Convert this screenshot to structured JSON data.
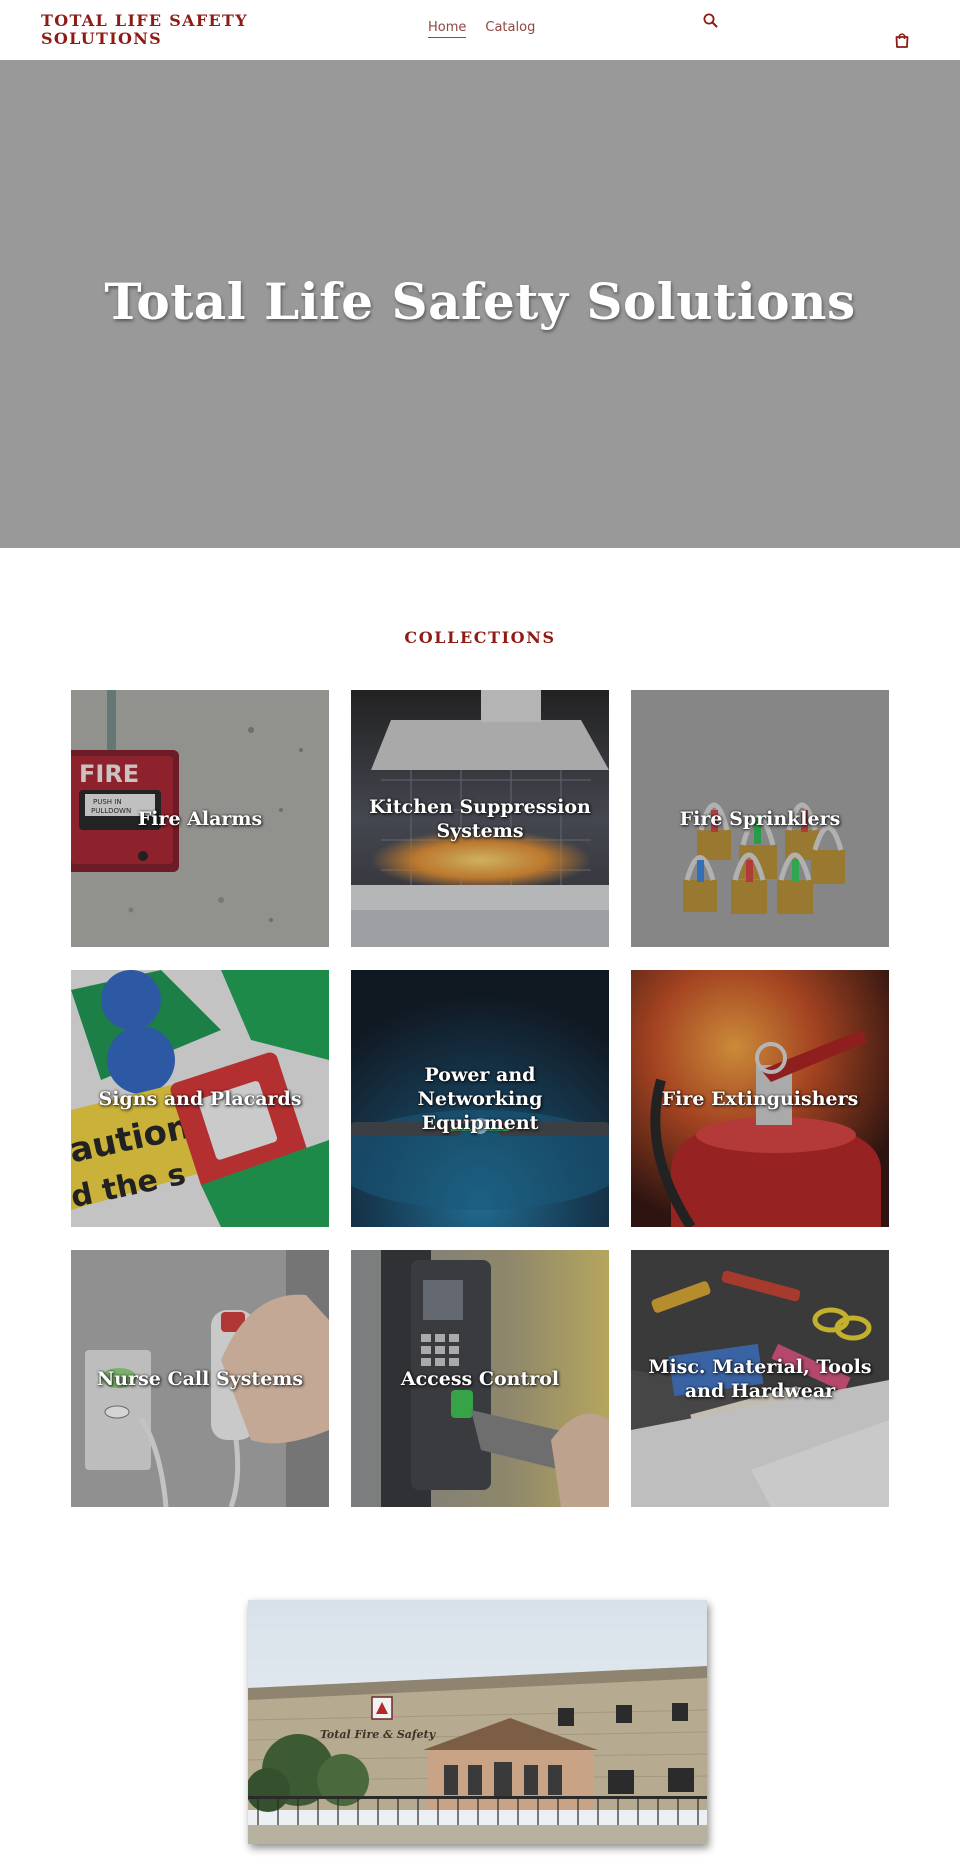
{
  "header": {
    "logo": "TOTAL LIFE SAFETY SOLUTIONS",
    "nav": [
      {
        "label": "Home",
        "active": true
      },
      {
        "label": "Catalog",
        "active": false
      }
    ],
    "search_icon": "search-icon",
    "cart_icon": "cart-icon"
  },
  "hero": {
    "title": "Total Life Safety Solutions",
    "background_color": "#999999"
  },
  "collections": {
    "title": "COLLECTIONS",
    "items": [
      {
        "label": "Fire Alarms"
      },
      {
        "label": "Kitchen Suppression Systems"
      },
      {
        "label": "Fire Sprinklers"
      },
      {
        "label": "Signs and Placards"
      },
      {
        "label": "Power and Networking Equipment"
      },
      {
        "label": "Fire Extinguishers"
      },
      {
        "label": "Nurse Call Systems"
      },
      {
        "label": "Access Control"
      },
      {
        "label": "Misc. Material, Tools and Hardwear"
      }
    ]
  },
  "building_image": {
    "sign_text": "Total Fire & Safety"
  },
  "colors": {
    "brand": "#8e1b14",
    "nav_text": "#8e4640"
  }
}
